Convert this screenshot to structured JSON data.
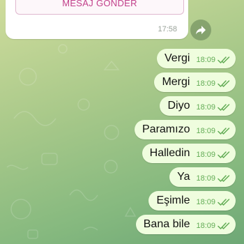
{
  "incoming_message": {
    "button_label": "MESAJ GÖNDER",
    "time": "17:58"
  },
  "share_icon": "share-arrow-icon",
  "outgoing_messages": [
    {
      "text": "Vergi",
      "time": "18:09",
      "status": "read"
    },
    {
      "text": "Mergi",
      "time": "18:09",
      "status": "read"
    },
    {
      "text": "Diyo",
      "time": "18:09",
      "status": "read"
    },
    {
      "text": "Paramızo",
      "time": "18:09",
      "status": "read"
    },
    {
      "text": "Halledin",
      "time": "18:09",
      "status": "read"
    },
    {
      "text": "Ya",
      "time": "18:09",
      "status": "read"
    },
    {
      "text": "Eşimle",
      "time": "18:09",
      "status": "read"
    },
    {
      "text": "Bana bile",
      "time": "18:09",
      "status": "read"
    }
  ],
  "colors": {
    "outgoing_bubble": "#effdde",
    "check_marks": "#62ac55",
    "button_text": "#c2408b"
  }
}
